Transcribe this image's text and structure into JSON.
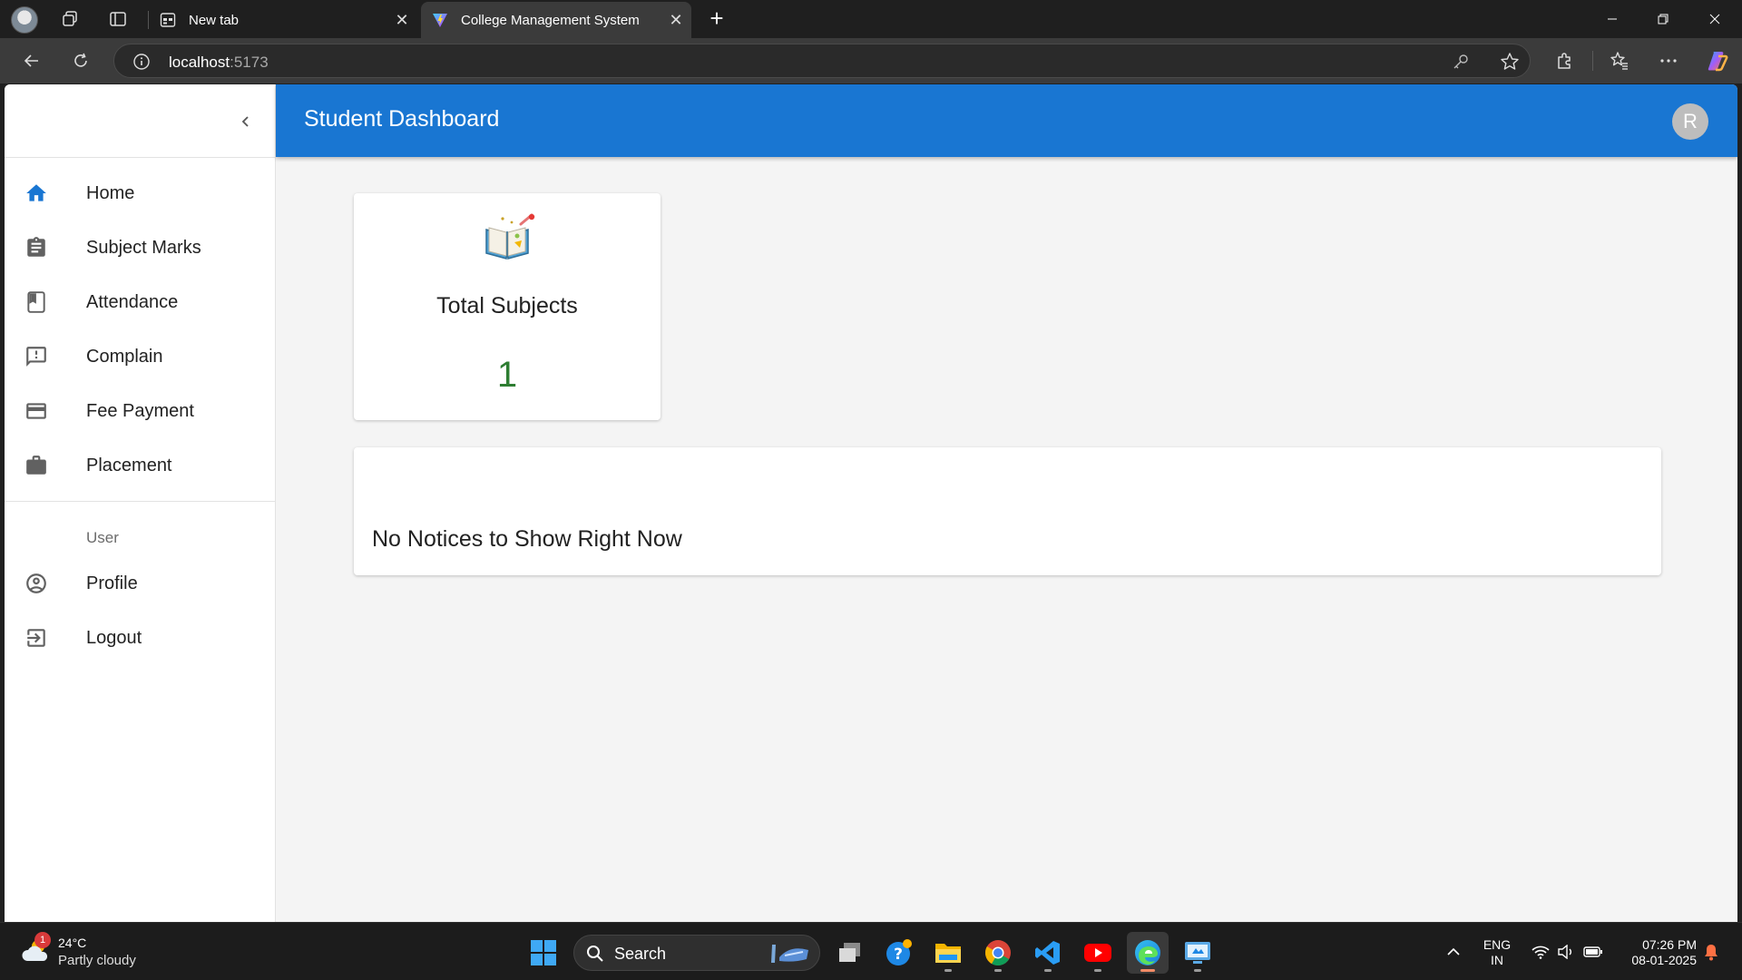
{
  "browser": {
    "tabs": [
      {
        "title": "New tab",
        "icon": "new-tab-page-icon",
        "active": false
      },
      {
        "title": "College Management System",
        "icon": "vite-favicon",
        "active": true
      }
    ],
    "address": {
      "host": "localhost",
      "port": ":5173"
    }
  },
  "app": {
    "title": "Student Dashboard",
    "avatar_initial": "R",
    "accent_color": "#1976d2",
    "sidebar": {
      "items": [
        {
          "label": "Home",
          "icon": "home-icon",
          "active": true
        },
        {
          "label": "Subject Marks",
          "icon": "assignment-icon"
        },
        {
          "label": "Attendance",
          "icon": "bookmark-icon"
        },
        {
          "label": "Complain",
          "icon": "feedback-icon"
        },
        {
          "label": "Fee Payment",
          "icon": "credit-card-icon"
        },
        {
          "label": "Placement",
          "icon": "briefcase-icon"
        }
      ],
      "section_label": "User",
      "user_items": [
        {
          "label": "Profile",
          "icon": "account-circle-icon"
        },
        {
          "label": "Logout",
          "icon": "exit-icon"
        }
      ]
    },
    "stats": {
      "title": "Total Subjects",
      "value": "1",
      "icon": "subjects-book-icon",
      "value_color": "#2e7d32"
    },
    "notice": {
      "text": "No Notices to Show Right Now"
    }
  },
  "taskbar": {
    "weather": {
      "temp": "24°C",
      "condition": "Partly cloudy",
      "badge": "1"
    },
    "search_label": "Search",
    "language": {
      "line1": "ENG",
      "line2": "IN"
    },
    "clock": {
      "time": "07:26 PM",
      "date": "08-01-2025"
    }
  }
}
